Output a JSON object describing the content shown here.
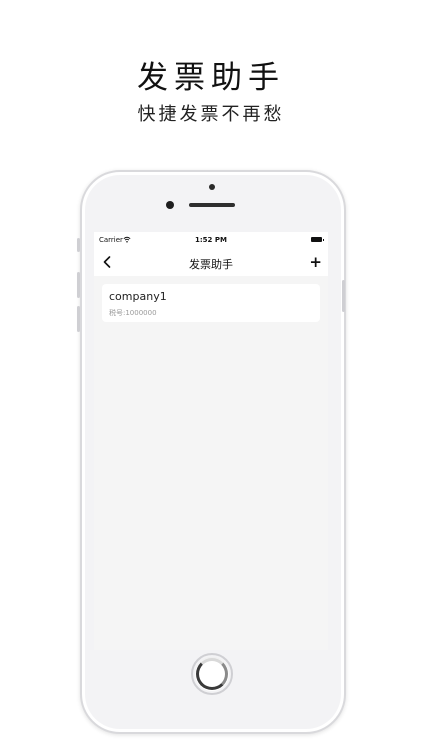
{
  "hero": {
    "title": "发票助手",
    "subtitle": "快捷发票不再愁"
  },
  "statusbar": {
    "carrier": "Carrier",
    "time": "1:52 PM",
    "wifi_icon": "wifi-icon",
    "battery_icon": "battery-icon"
  },
  "navbar": {
    "back_icon": "chevron-left-icon",
    "title": "发票助手",
    "add_label": "+"
  },
  "companies": [
    {
      "name": "company1",
      "tax_id": "税号:1000000"
    }
  ],
  "colors": {
    "screen_background": "#f5f5f5",
    "card_background": "#ffffff",
    "secondary_text": "#9a9a9a"
  }
}
